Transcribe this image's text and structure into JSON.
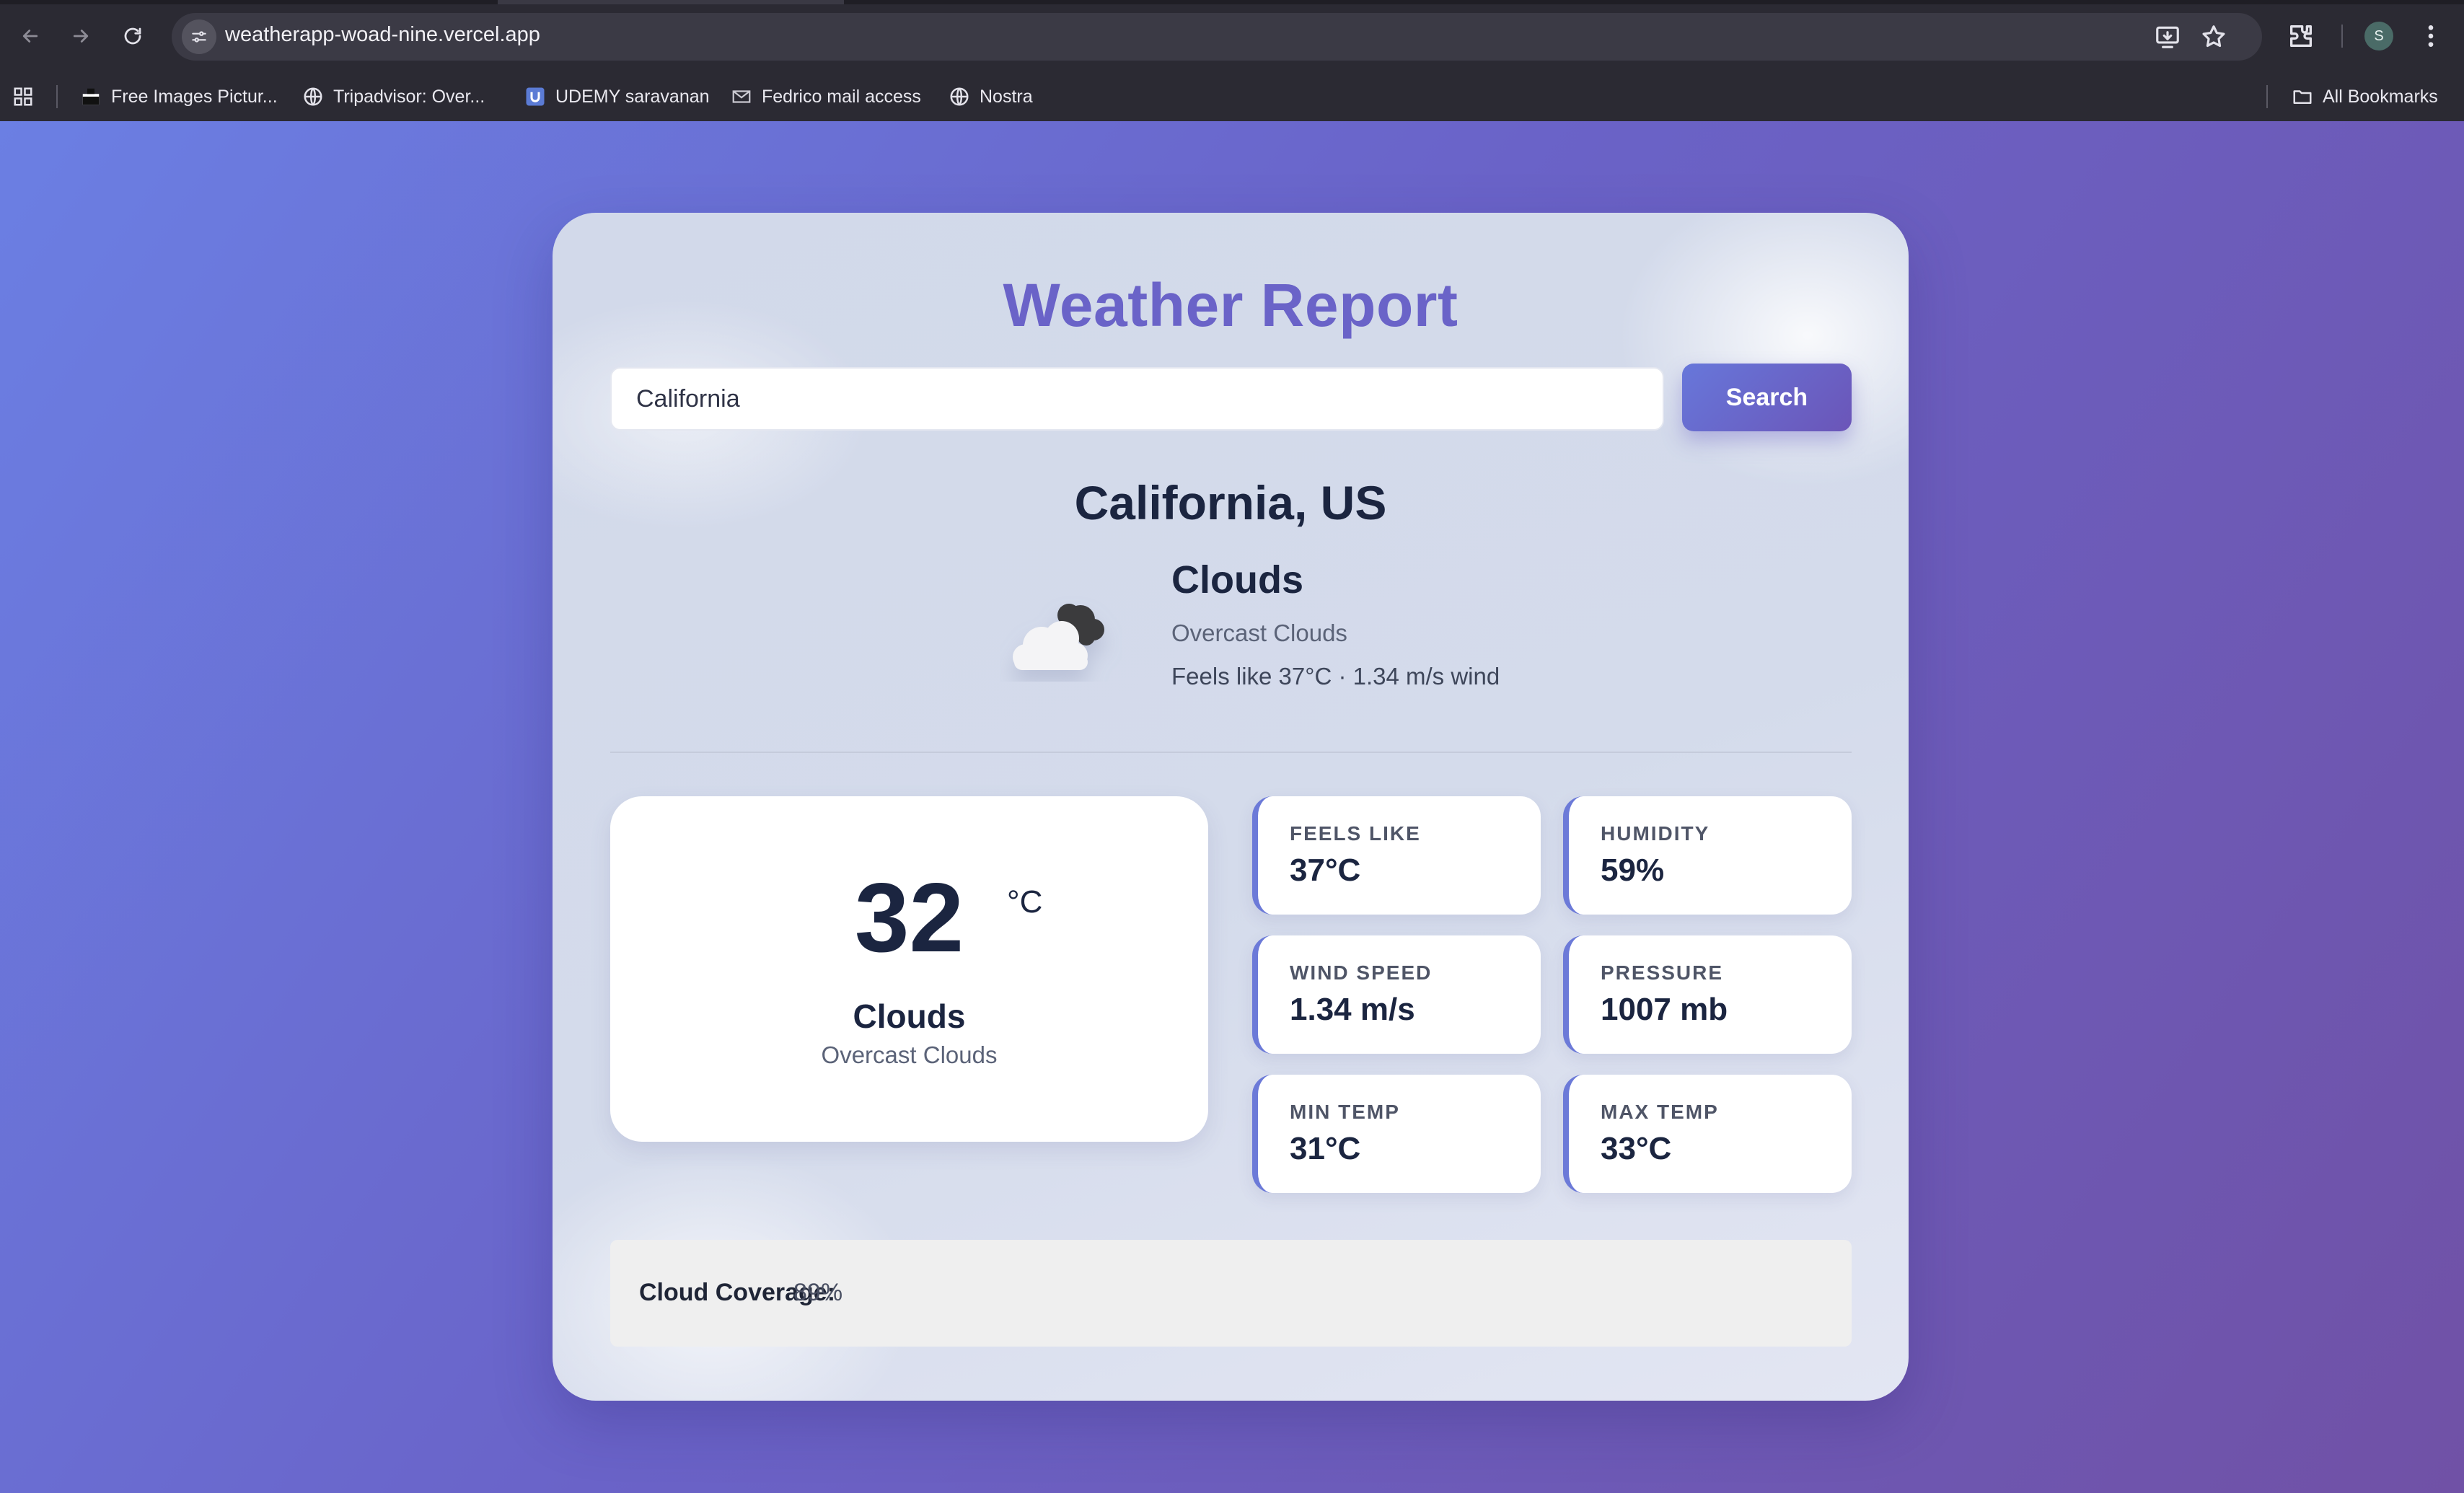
{
  "browser": {
    "url": "weatherapp-woad-nine.vercel.app",
    "profile_initial": "S",
    "bookmarks": [
      {
        "label": "Free Images Pictur...",
        "icon": "image-bookmark-icon"
      },
      {
        "label": "Tripadvisor: Over...",
        "icon": "globe-icon"
      },
      {
        "label": "UDEMY saravanan",
        "icon": "udemy-icon"
      },
      {
        "label": "Fedrico mail access",
        "icon": "mail-icon"
      },
      {
        "label": "Nostra",
        "icon": "globe-icon"
      }
    ],
    "all_bookmarks_label": "All Bookmarks"
  },
  "app": {
    "title": "Weather Report",
    "search": {
      "value": "California",
      "button_label": "Search"
    },
    "location": "California, US",
    "condition": {
      "main": "Clouds",
      "description": "Overcast Clouds",
      "extra": "Feels like 37°C · 1.34 m/s wind",
      "icon": "cloud-icon"
    },
    "temperature": {
      "value": "32",
      "unit": "°C",
      "condition": "Clouds",
      "description": "Overcast Clouds"
    },
    "stats": [
      {
        "label": "FEELS LIKE",
        "value": "37°C"
      },
      {
        "label": "HUMIDITY",
        "value": "59%"
      },
      {
        "label": "WIND SPEED",
        "value": "1.34 m/s"
      },
      {
        "label": "PRESSURE",
        "value": "1007 mb"
      },
      {
        "label": "MIN TEMP",
        "value": "31°C"
      },
      {
        "label": "MAX TEMP",
        "value": "33°C"
      }
    ],
    "cloud_coverage": {
      "label": "Cloud Coverage:",
      "value": "89%"
    }
  },
  "colors": {
    "accent": "#6a63c8",
    "text_dark": "#1b2540",
    "stat_border": "#6c7ad8"
  }
}
